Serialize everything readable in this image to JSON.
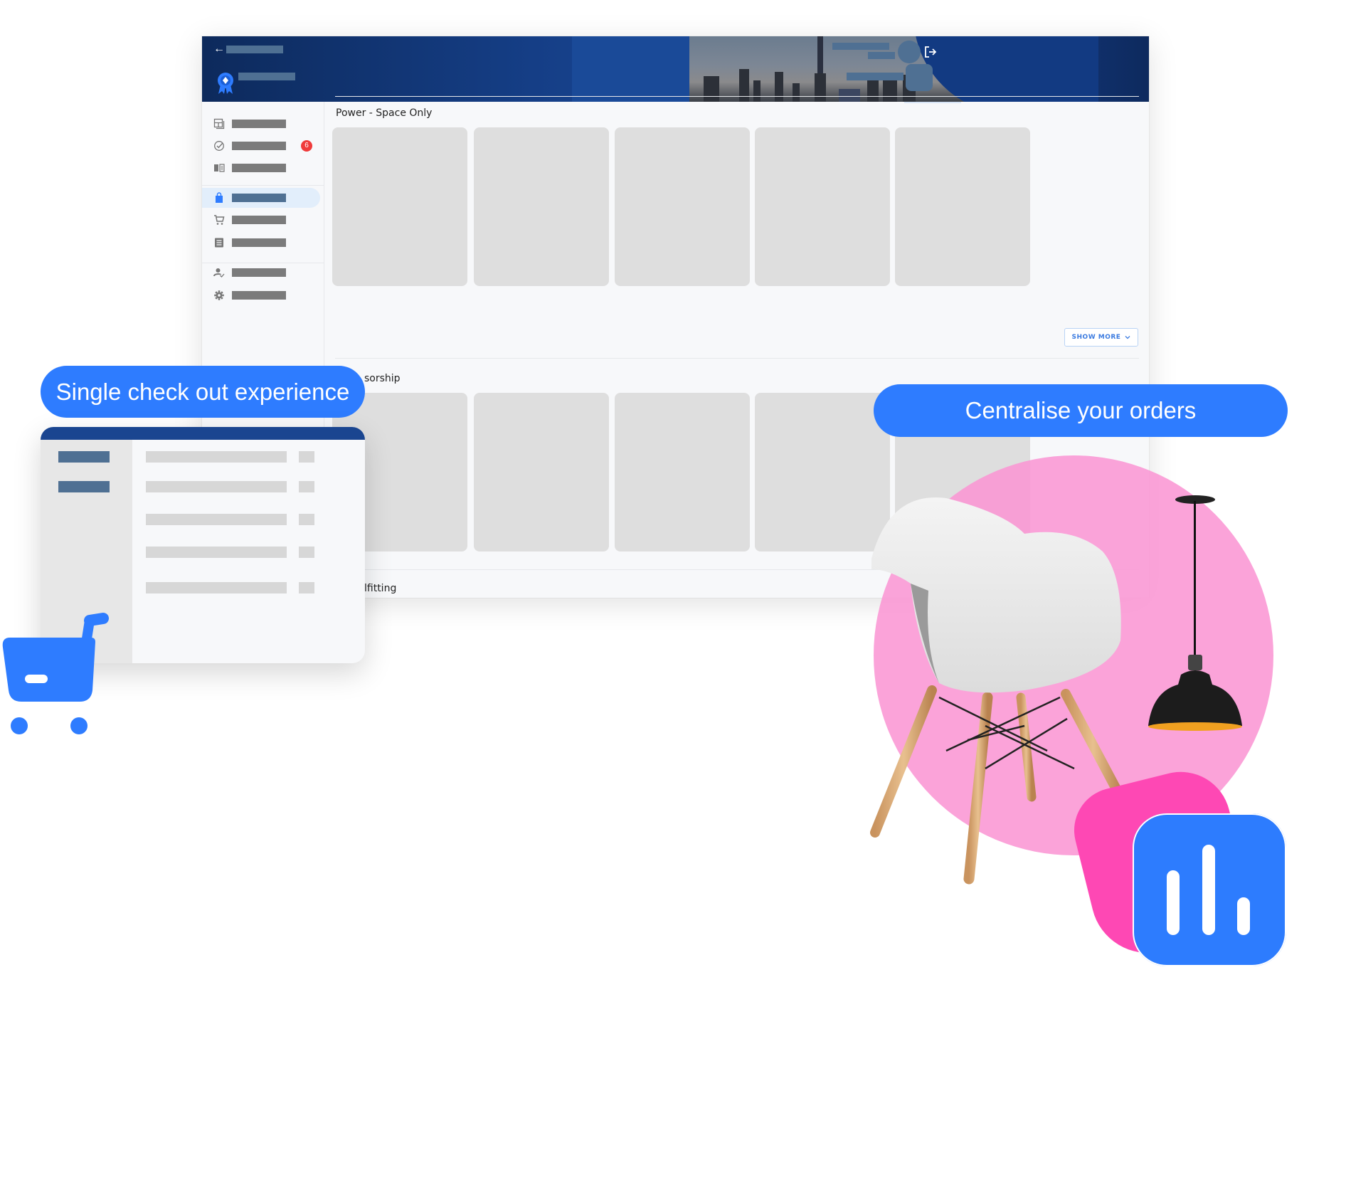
{
  "window": {
    "header": {
      "back_icon": "arrow-left-icon",
      "logo_icon": "award-ribbon-icon",
      "logout_icon": "logout-icon"
    },
    "sidebar": {
      "items": [
        {
          "icon": "dashboard-icon",
          "active": false
        },
        {
          "icon": "check-circle-icon",
          "active": false,
          "badge": "6"
        },
        {
          "icon": "book-open-icon",
          "active": false
        },
        {
          "icon": "shopping-bag-icon",
          "active": true
        },
        {
          "icon": "cart-icon",
          "active": false
        },
        {
          "icon": "list-icon",
          "active": false
        },
        {
          "icon": "user-check-icon",
          "active": false
        },
        {
          "icon": "gear-icon",
          "active": false
        }
      ]
    },
    "sections": [
      {
        "title": "Power - Space Only",
        "card_count": 5,
        "show_more": "SHOW MORE"
      },
      {
        "title": "sorship",
        "card_count": 5
      },
      {
        "title": "lfitting"
      }
    ]
  },
  "callouts": {
    "checkout": "Single check out experience",
    "orders": "Centralise your orders"
  },
  "colors": {
    "brand_blue": "#2e7cff",
    "header_navy": "#153e86",
    "pink": "#fa96d4",
    "hot_pink": "#fe48b4",
    "badge_red": "#ef3b3b"
  },
  "decor": {
    "cart_icon": "shopping-cart-icon",
    "stats_icon": "bar-chart-icon",
    "chair": "armchair-illustration",
    "lamp": "pendant-lamp-illustration"
  }
}
